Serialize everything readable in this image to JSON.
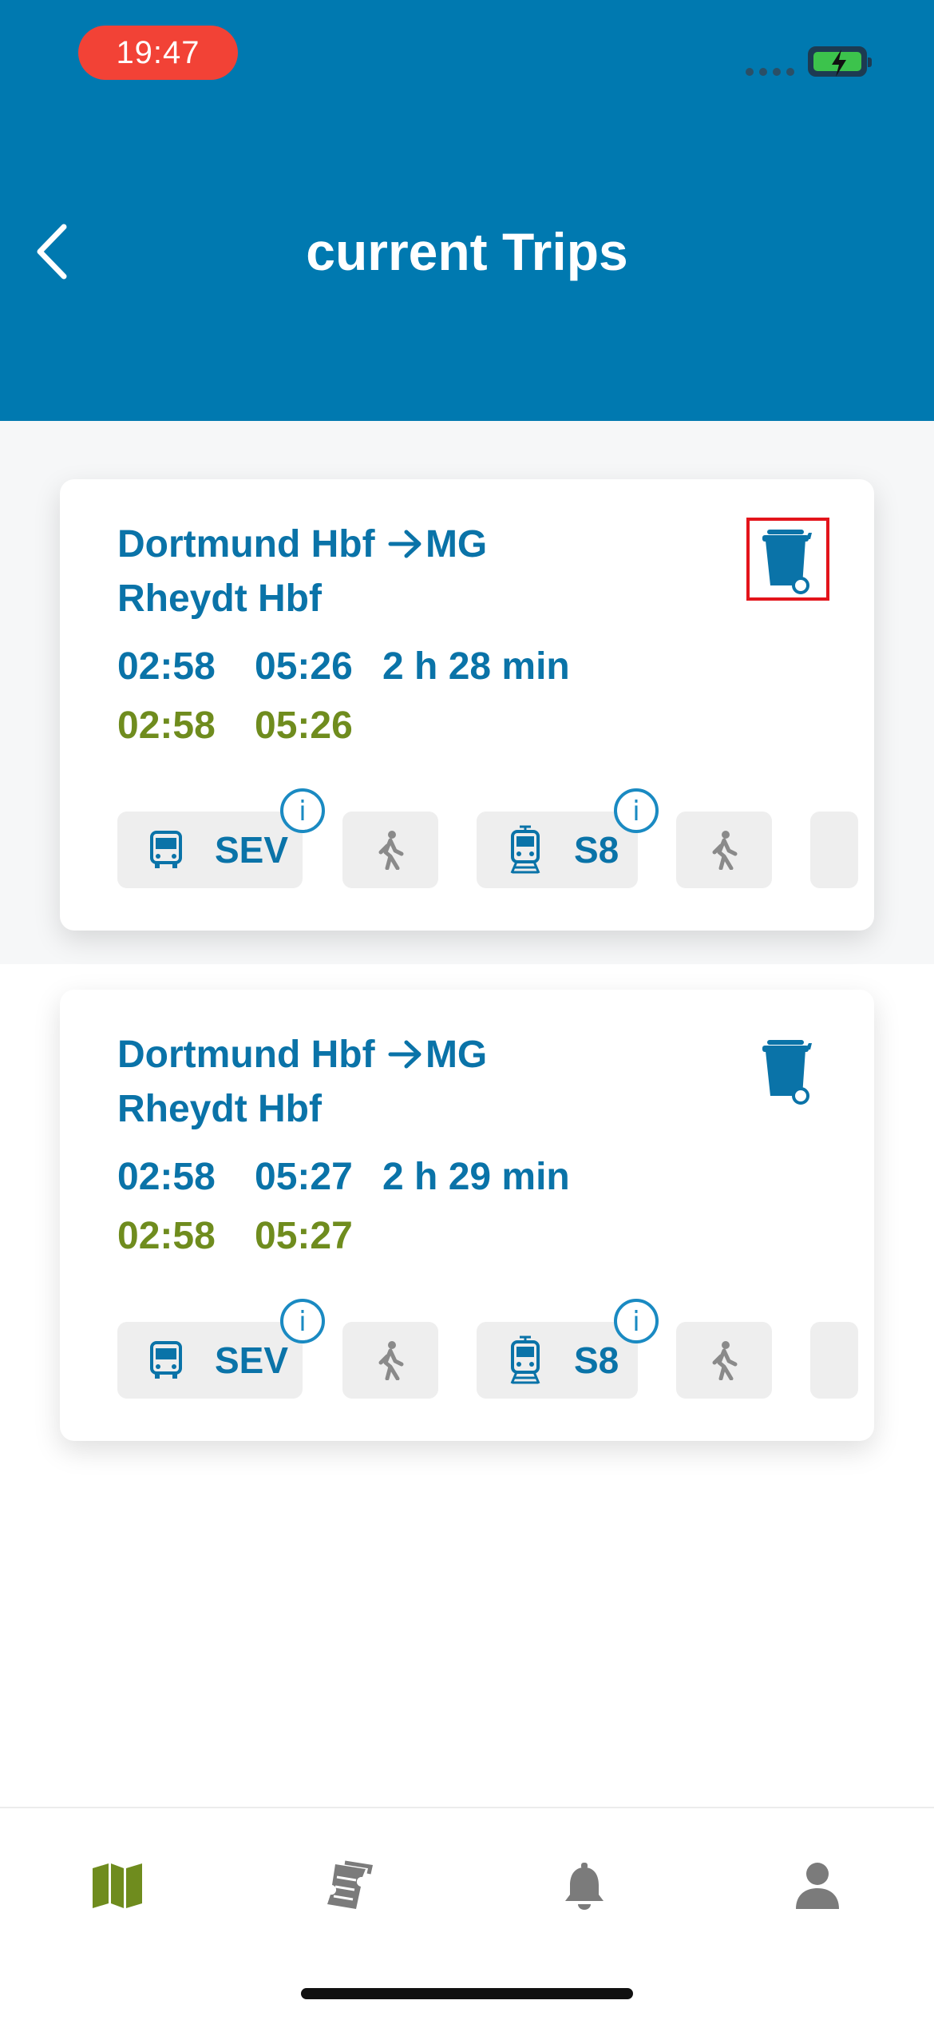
{
  "status_bar": {
    "time": "19:47"
  },
  "header": {
    "title": "current Trips"
  },
  "colors": {
    "brand": "#0079b0",
    "text_blue": "#0a73a8",
    "planned_green": "#6f8c1e",
    "highlight": "#e3141b"
  },
  "trips": [
    {
      "route_from": "Dortmund Hbf",
      "route_to_line1": "MG",
      "route_to_line2": "Rheydt Hbf",
      "departure": "02:58",
      "arrival": "05:26",
      "duration": "2 h 28 min",
      "planned_departure": "02:58",
      "planned_arrival": "05:26",
      "legs": [
        {
          "type": "bus-icon",
          "label": "SEV",
          "info": "i"
        },
        {
          "type": "walk-icon"
        },
        {
          "type": "tram-icon",
          "label": "S8",
          "info": "i"
        },
        {
          "type": "walk-icon"
        }
      ]
    },
    {
      "route_from": "Dortmund Hbf",
      "route_to_line1": "MG",
      "route_to_line2": "Rheydt Hbf",
      "departure": "02:58",
      "arrival": "05:27",
      "duration": "2 h 29 min",
      "planned_departure": "02:58",
      "planned_arrival": "05:27",
      "legs": [
        {
          "type": "bus-icon",
          "label": "SEV",
          "info": "i"
        },
        {
          "type": "walk-icon"
        },
        {
          "type": "tram-icon",
          "label": "S8",
          "info": "i"
        },
        {
          "type": "walk-icon"
        }
      ]
    }
  ],
  "tabbar": {
    "items": [
      {
        "icon": "map-icon",
        "active": true
      },
      {
        "icon": "tickets-icon",
        "active": false
      },
      {
        "icon": "bell-icon",
        "active": false
      },
      {
        "icon": "profile-icon",
        "active": false
      }
    ]
  }
}
